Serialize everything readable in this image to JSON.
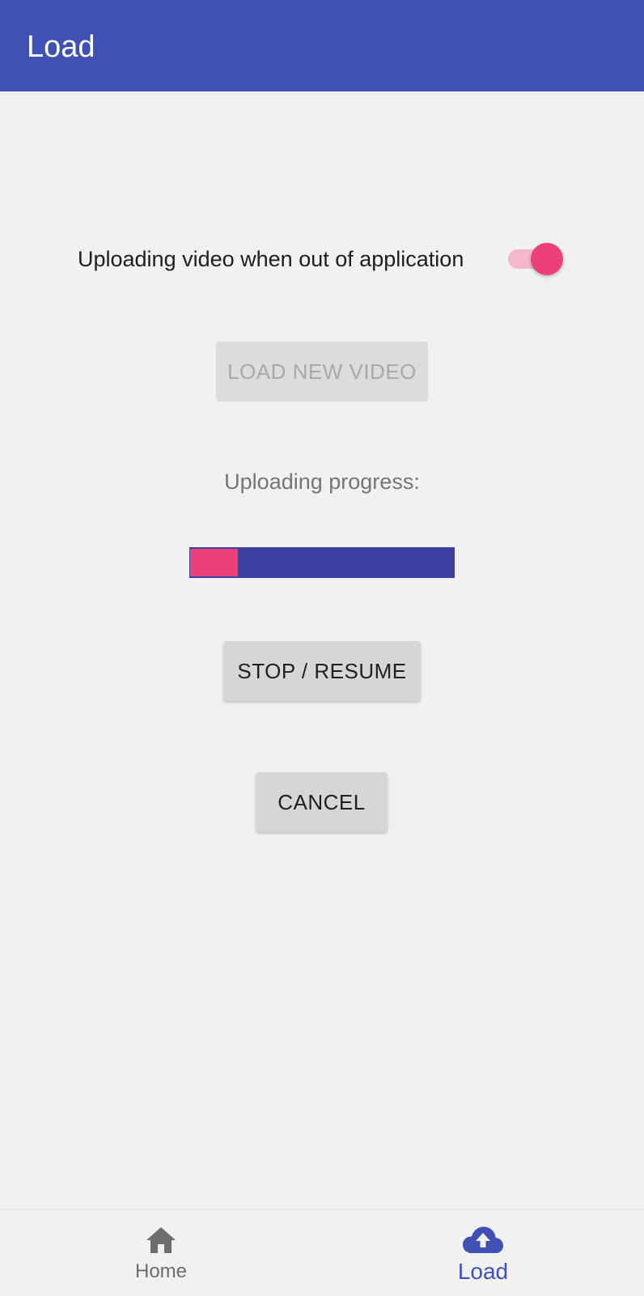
{
  "app_bar": {
    "title": "Load",
    "color": "#3f51b5"
  },
  "upload_toggle": {
    "label": "Uploading video when out of application",
    "checked": true,
    "accent_color": "#ec407a"
  },
  "load_button": {
    "label": "LOAD NEW VIDEO",
    "enabled": false
  },
  "progress": {
    "label": "Uploading progress:",
    "percent": 18,
    "fill_color": "#ec407a",
    "track_color": "#3a3fa0"
  },
  "stop_resume_button": {
    "label": "STOP / RESUME"
  },
  "cancel_button": {
    "label": "CANCEL"
  },
  "bottom_nav": {
    "items": [
      {
        "label": "Home",
        "icon": "home-icon",
        "selected": false
      },
      {
        "label": "Load",
        "icon": "cloud-upload-icon",
        "selected": true
      }
    ]
  }
}
